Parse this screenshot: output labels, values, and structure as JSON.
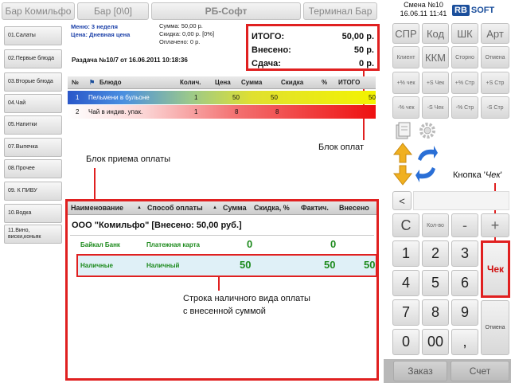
{
  "top": {
    "btn_bar_komilfo": "Бар Комильфо",
    "btn_bar_00": "Бар [0\\0]",
    "btn_rb_soft": "РБ-Софт",
    "btn_terminal": "Терминал Бар",
    "smena": "Смена №10",
    "datetime": "16.06.11 11:41",
    "logo_rb": "RB",
    "logo_soft": "SOFT"
  },
  "categories": [
    "01.Салаты",
    "02.Первые блюда",
    "03.Вторые блюда",
    "04.Чай",
    "05.Напитки",
    "07.Выпечка",
    "08.Прочее",
    "09. К ПИВУ",
    "10.Водка",
    "11.Вино, виски,коньяк"
  ],
  "info": {
    "menu": "Меню: 3 неделя",
    "price": "Цена: Дневная цена",
    "sum": "Сумма: 50,00 р.",
    "discount": "Скидка: 0,00 р. [0%]",
    "paid": "Оплачено: 0 р.",
    "razdacha": "Раздача №10/7 от 16.06.2011 10:18:36"
  },
  "totals": {
    "itogo_label": "ИТОГО:",
    "itogo_value": "50,00 р.",
    "vneseno_label": "Внесено:",
    "vneseno_value": "50 р.",
    "sdacha_label": "Сдача:",
    "sdacha_value": "0 р."
  },
  "items_table": {
    "headers": {
      "num": "№",
      "dish": "Блюдо",
      "qty": "Колич.",
      "price": "Цена",
      "sum": "Сумма",
      "disc": "Скидка",
      "pct": "%",
      "total": "ИТОГО"
    },
    "rows": [
      {
        "num": "1",
        "dish": "Пельмени в бульоне",
        "qty": "1",
        "price": "50",
        "sum": "50",
        "total": "50"
      },
      {
        "num": "2",
        "dish": "Чай в индив. упак.",
        "qty": "1",
        "price": "8",
        "sum": "8",
        "total": ""
      }
    ]
  },
  "payment": {
    "headers": {
      "name": "Наименование",
      "method": "Способ оплаты",
      "sum": "Сумма",
      "disc": "Скидка, %",
      "fact": "Фактич.",
      "vneseno": "Внесено"
    },
    "org": "ООО \"Комильфо\" [Внесено: 50,00 руб.]",
    "rows": [
      {
        "name": "Байкал Банк",
        "method": "Платежная карта",
        "sum": "0",
        "fact": "0"
      },
      {
        "name": "Наличные",
        "method": "Наличный",
        "sum": "50",
        "fact": "50",
        "vneseno": "50"
      }
    ]
  },
  "annotations": {
    "blok_oplat": "Блок оплат",
    "blok_priema": "Блок приема оплаты",
    "knopka_chek_prefix": "Кнопка '",
    "knopka_chek_word": "Чек",
    "knopka_chek_suffix": "'",
    "stroka_line1": "Строка наличного вида оплаты",
    "stroka_line2": "с внесенной суммой"
  },
  "keypad": {
    "spr": "СПР",
    "kod": "Код",
    "shk": "ШК",
    "art": "Арт",
    "klient": "Клиент",
    "kkm": "ККМ",
    "storno": "Сторно",
    "otmena_small": "Отмена",
    "pct_chek_plus": "+% чек",
    "s_chek_plus": "+S Чек",
    "pct_str_plus": "+% Стр",
    "s_str_plus": "+S Стр",
    "pct_chek_minus": "-% чек",
    "s_chek_minus": "-S Чек",
    "pct_str_minus": "-% Стр",
    "s_str_minus": "-S Стр",
    "back": "<",
    "c": "C",
    "kolvo": "Кол-во",
    "minus": "-",
    "plus": "+",
    "n1": "1",
    "n2": "2",
    "n3": "3",
    "n4": "4",
    "n5": "5",
    "n6": "6",
    "n7": "7",
    "n8": "8",
    "n9": "9",
    "n0": "0",
    "n00": "00",
    "comma": ",",
    "chek": "Чек",
    "otmena": "Отмена",
    "zakaz": "Заказ",
    "schet": "Счет"
  },
  "colors": {
    "accent_red": "#e02020",
    "logo_blue": "#1b4f9c",
    "pay_green": "#1c8a1c"
  }
}
